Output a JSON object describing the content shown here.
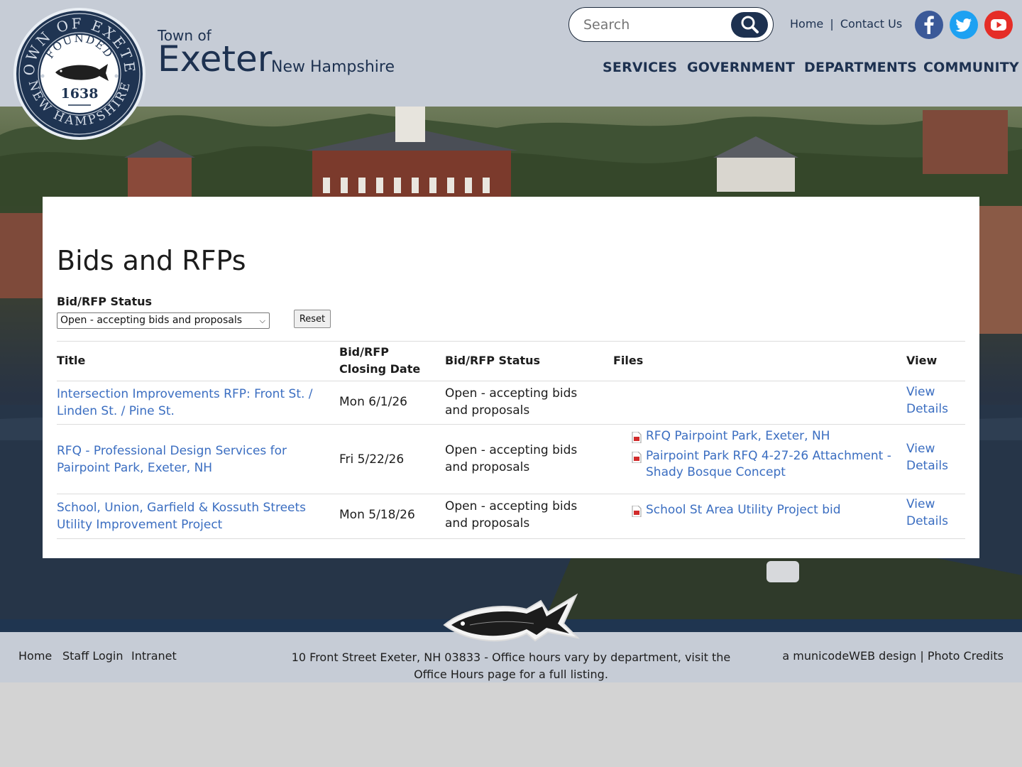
{
  "header": {
    "seal": {
      "ring_top": "TOWN OF EXETER",
      "ring_bottom": "NEW HAMPSHIRE",
      "founded": "FOUNDED",
      "year": "1638"
    },
    "town_of": "Town of",
    "town_name": "Exeter",
    "state": "New Hampshire",
    "search_placeholder": "Search",
    "util_links": [
      "Home",
      "Contact Us"
    ],
    "util_separator": "|",
    "nav": [
      "SERVICES",
      "GOVERNMENT",
      "DEPARTMENTS",
      "COMMUNITY"
    ],
    "social_icons": [
      "facebook-icon",
      "twitter-icon",
      "youtube-icon"
    ]
  },
  "page": {
    "title": "Bids and RFPs",
    "filter_label": "Bid/RFP Status",
    "filter_value": "Open - accepting bids and proposals",
    "reset_label": "Reset"
  },
  "table": {
    "headers": [
      "Title",
      "Bid/RFP Closing Date",
      "Bid/RFP Status",
      "Files",
      "View"
    ],
    "rows": [
      {
        "title": "Intersection Improvements RFP: Front St. / Linden St. / Pine St.",
        "closing": "Mon 6/1/26",
        "status": "Open - accepting bids and proposals",
        "files": [],
        "view": "View Details"
      },
      {
        "title": "RFQ - Professional Design Services for Pairpoint Park, Exeter, NH",
        "closing": "Fri 5/22/26",
        "status": "Open - accepting bids and proposals",
        "files": [
          "RFQ Pairpoint Park, Exeter, NH",
          "Pairpoint Park RFQ 4-27-26 Attachment - Shady Bosque Concept"
        ],
        "view": "View Details"
      },
      {
        "title": "School, Union, Garfield & Kossuth Streets Utility Improvement Project",
        "closing": "Mon 5/18/26",
        "status": "Open - accepting bids and proposals",
        "files": [
          "School St Area Utility Project bid"
        ],
        "view": "View Details"
      }
    ]
  },
  "footer": {
    "links": [
      "Home",
      "Staff Login",
      "Intranet"
    ],
    "address": "10 Front Street Exeter, NH 03833 - Office hours vary by department, visit the Office Hours page for a full listing.",
    "credit": "a municodeWEB design | Photo Credits"
  },
  "colors": {
    "navy": "#1d3150",
    "link": "#3b6ec1",
    "header_bg": "#c6ccd6",
    "footer_band": "#1f3550"
  }
}
